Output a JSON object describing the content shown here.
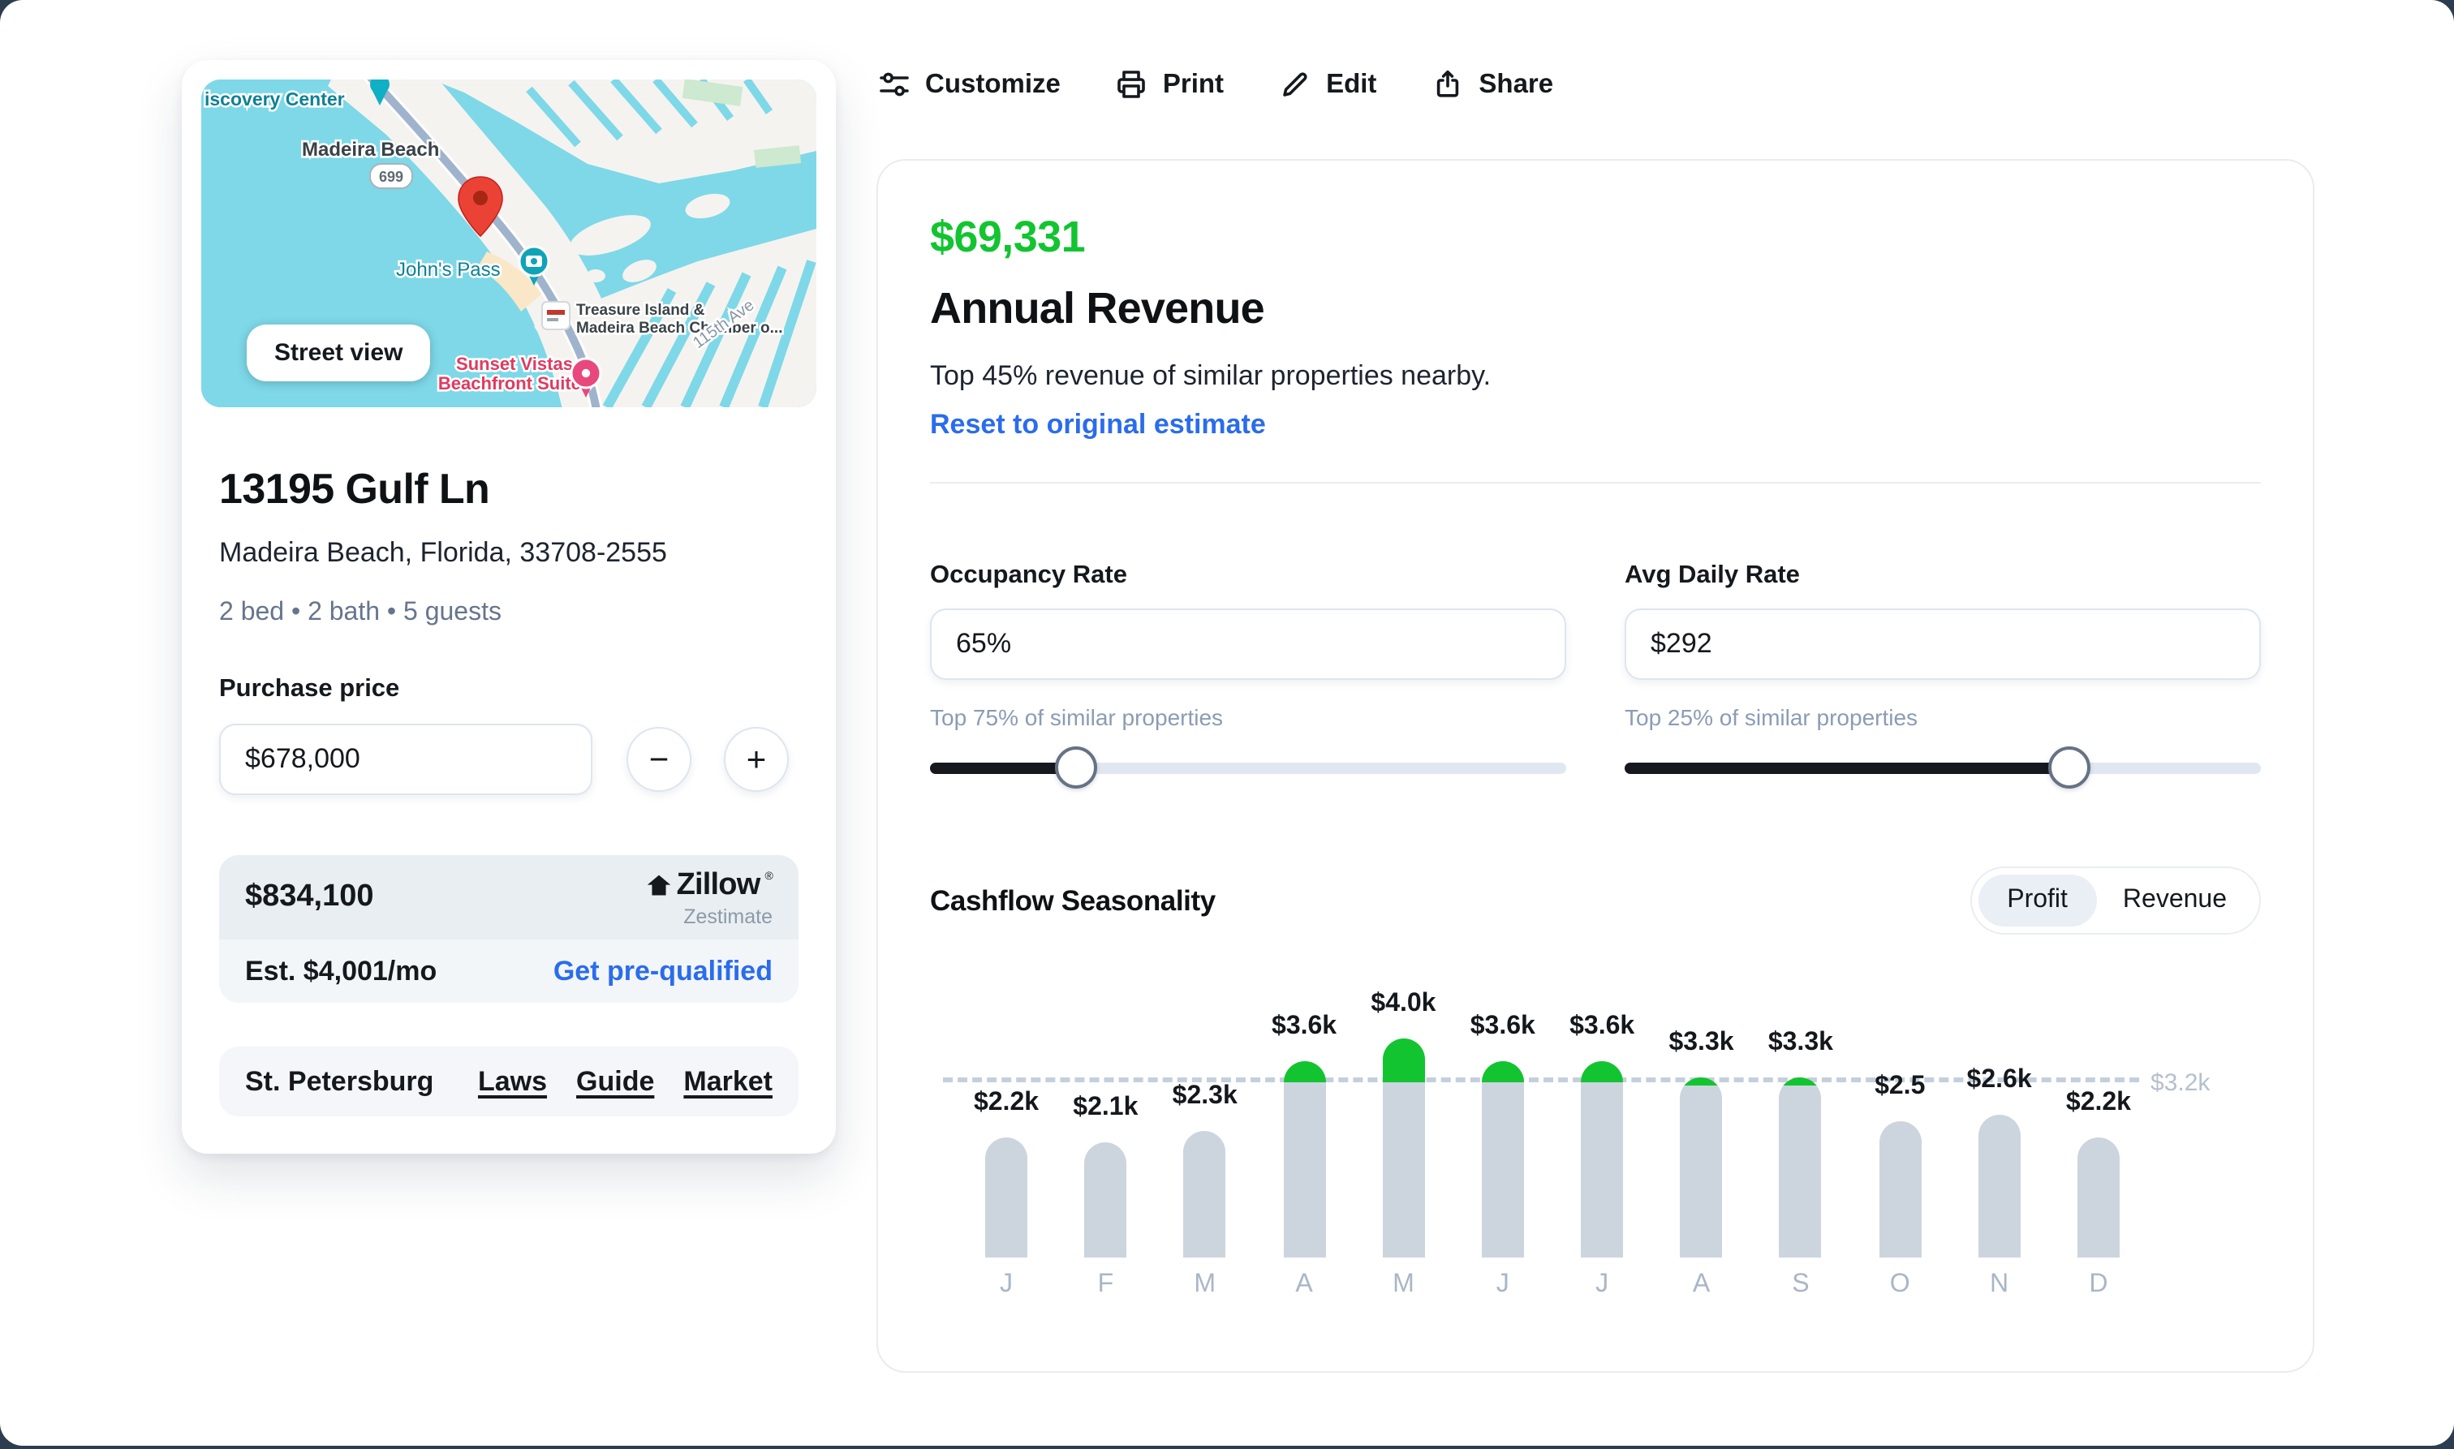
{
  "toolbar": {
    "customize_label": "Customize",
    "print_label": "Print",
    "edit_label": "Edit",
    "share_label": "Share"
  },
  "property_card": {
    "map": {
      "street_view_label": "Street view",
      "labels": {
        "discovery_center": "iscovery Center",
        "madeira_beach": "Madeira Beach",
        "route_shield": "699",
        "johns_pass": "John's Pass",
        "chamber_line1": "Treasure Island &",
        "chamber_line2": "Madeira Beach Chamber o...",
        "sunset_line1": "Sunset Vistas",
        "sunset_line2": "Beachfront Suites",
        "street_115": "115th Ave"
      }
    },
    "address": "13195 Gulf Ln",
    "city_line": "Madeira Beach, Florida, 33708-2555",
    "specs": "2 bed • 2 bath • 5 guests",
    "purchase_price_label": "Purchase price",
    "purchase_price_value": "$678,000",
    "minus_label": "−",
    "plus_label": "+",
    "zestimate": {
      "value": "$834,100",
      "brand": "Zillow",
      "registered_mark": "®",
      "brand_sub": "Zestimate",
      "monthly": "Est. $4,001/mo",
      "prequalify_link": "Get pre-qualified"
    },
    "market": {
      "city": "St. Petersburg",
      "links": [
        "Laws",
        "Guide",
        "Market"
      ]
    }
  },
  "revenue_panel": {
    "amount": "$69,331",
    "title": "Annual Revenue",
    "subtitle": "Top 45% revenue of similar properties nearby.",
    "reset_link": "Reset to original estimate",
    "occupancy": {
      "label": "Occupancy Rate",
      "value": "65%",
      "hint": "Top 75% of similar properties",
      "slider_percent": 23
    },
    "avg_daily_rate": {
      "label": "Avg Daily Rate",
      "value": "$292",
      "hint": "Top 25% of similar properties",
      "slider_percent": 70
    },
    "seasonality": {
      "title": "Cashflow Seasonality",
      "toggle_profit": "Profit",
      "toggle_revenue": "Revenue",
      "active": "Profit"
    },
    "chart_data": {
      "type": "bar",
      "title": "Cashflow Seasonality",
      "categories": [
        "J",
        "F",
        "M",
        "A",
        "M",
        "J",
        "J",
        "A",
        "S",
        "O",
        "N",
        "D"
      ],
      "values": [
        2.2,
        2.1,
        2.3,
        3.6,
        4.0,
        3.6,
        3.6,
        3.3,
        3.3,
        2.5,
        2.6,
        2.2
      ],
      "bar_labels": [
        "$2.2k",
        "$2.1k",
        "$2.3k",
        "$3.6k",
        "$4.0k",
        "$3.6k",
        "$3.6k",
        "$3.3k",
        "$3.3k",
        "$2.5",
        "$2.6k",
        "$2.2k"
      ],
      "reference_line": {
        "value": 3.2,
        "label": "$3.2k"
      },
      "ylim": [
        0,
        4.4
      ],
      "grid": false,
      "legend": false,
      "bar_color": "#ccd5de",
      "above_line_color": "#13c431",
      "line_color": "#c5cfdc",
      "month_color": "#a9b6c6"
    }
  },
  "colors": {
    "accent_green": "#13c431",
    "link_blue": "#2b6cec",
    "water": "#7ed8e8",
    "pin_red": "#ea4335",
    "map_teal": "#0c8196",
    "map_pink": "#e5345f",
    "bar_gray": "#ccd5de"
  }
}
